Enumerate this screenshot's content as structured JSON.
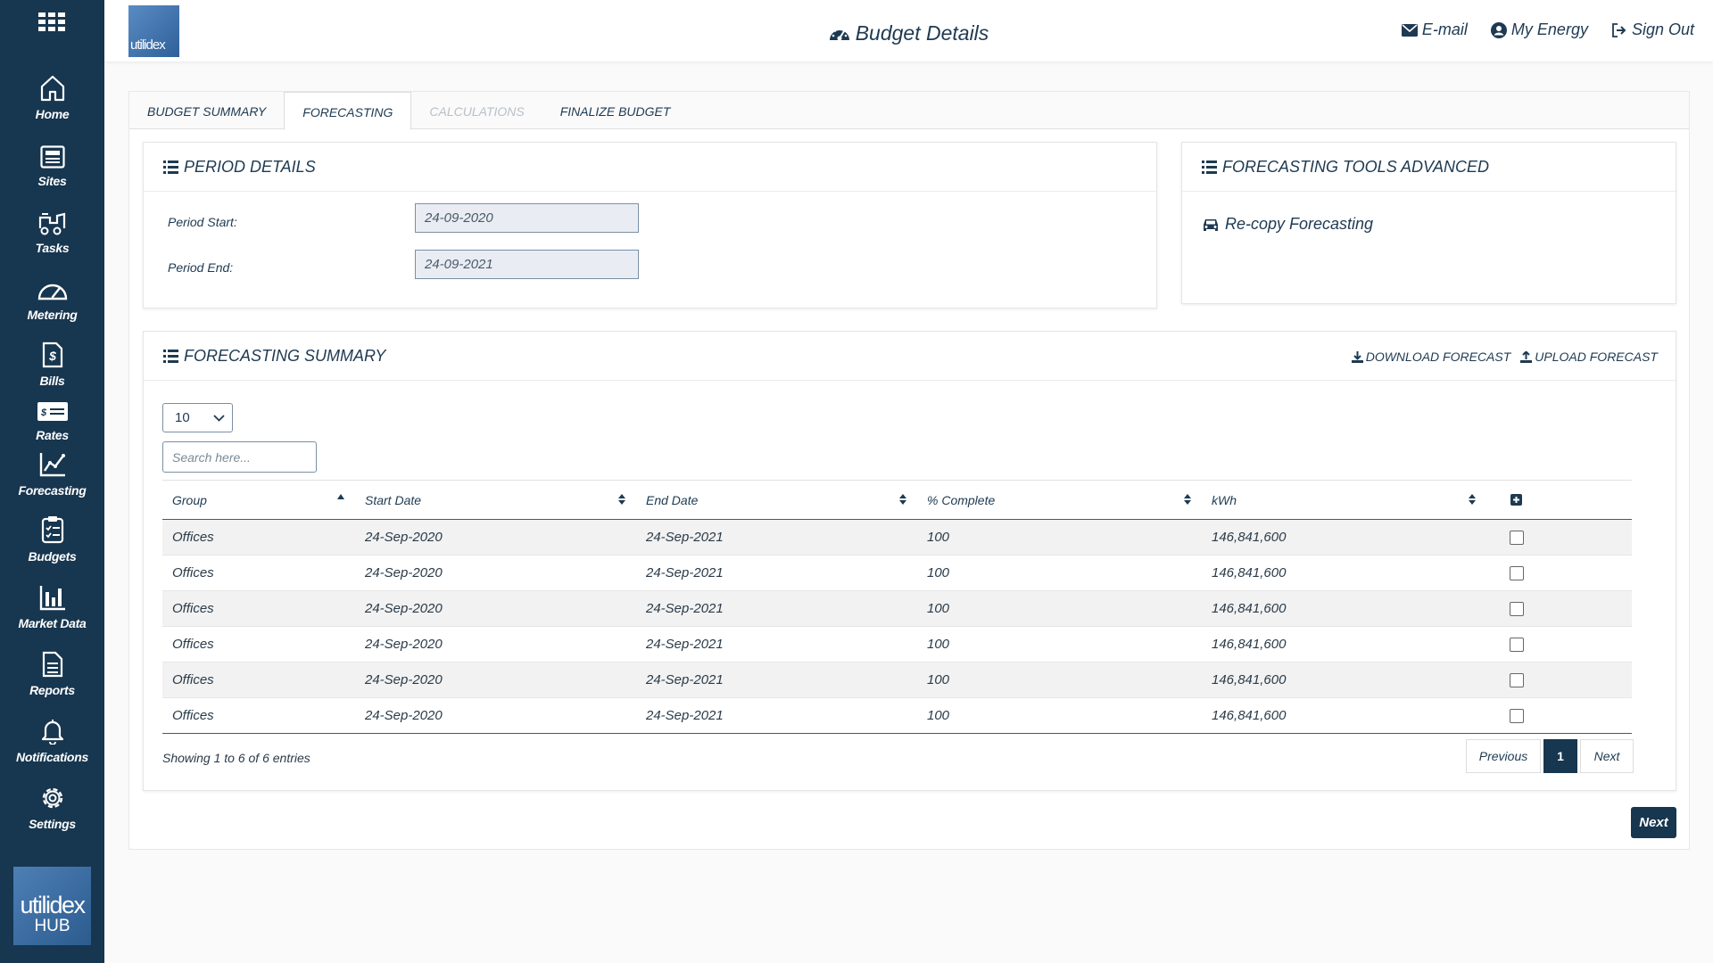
{
  "sidebar": {
    "items": [
      {
        "label": "Home",
        "icon": "home-icon"
      },
      {
        "label": "Sites",
        "icon": "sites-icon"
      },
      {
        "label": "Tasks",
        "icon": "tasks-icon"
      },
      {
        "label": "Metering",
        "icon": "gauge-icon"
      },
      {
        "label": "Bills",
        "icon": "bill-icon"
      },
      {
        "label": "Rates",
        "icon": "rates-icon"
      },
      {
        "label": "Forecasting",
        "icon": "line-chart-icon"
      },
      {
        "label": "Budgets",
        "icon": "clipboard-icon"
      },
      {
        "label": "Market Data",
        "icon": "bar-chart-icon"
      },
      {
        "label": "Reports",
        "icon": "report-icon"
      },
      {
        "label": "Notifications",
        "icon": "bell-icon"
      },
      {
        "label": "Settings",
        "icon": "gear-icon"
      }
    ],
    "logo": {
      "line1": "utilidex",
      "line2": "HUB"
    }
  },
  "header": {
    "logo_text": "utilidex",
    "title": "Budget Details",
    "links": {
      "email": "E-mail",
      "my_energy": "My Energy",
      "sign_out": "Sign Out"
    }
  },
  "tabs": [
    {
      "label": "BUDGET SUMMARY"
    },
    {
      "label": "FORECASTING"
    },
    {
      "label": "CALCULATIONS"
    },
    {
      "label": "FINALIZE BUDGET"
    }
  ],
  "period": {
    "title": "PERIOD DETAILS",
    "start_label": "Period Start:",
    "start_value": "24-09-2020",
    "end_label": "Period End:",
    "end_value": "24-09-2021"
  },
  "tools": {
    "title": "FORECASTING TOOLS ADVANCED",
    "recopy": "Re-copy Forecasting"
  },
  "summary": {
    "title": "FORECASTING SUMMARY",
    "download": "DOWNLOAD FORECAST",
    "upload": "UPLOAD FORECAST",
    "page_length": "10",
    "search_placeholder": "Search here...",
    "columns": [
      "Group",
      "Start Date",
      "End Date",
      "% Complete",
      "kWh"
    ],
    "rows": [
      [
        "Offices",
        "24-Sep-2020",
        "24-Sep-2021",
        "100",
        "146,841,600"
      ],
      [
        "Offices",
        "24-Sep-2020",
        "24-Sep-2021",
        "100",
        "146,841,600"
      ],
      [
        "Offices",
        "24-Sep-2020",
        "24-Sep-2021",
        "100",
        "146,841,600"
      ],
      [
        "Offices",
        "24-Sep-2020",
        "24-Sep-2021",
        "100",
        "146,841,600"
      ],
      [
        "Offices",
        "24-Sep-2020",
        "24-Sep-2021",
        "100",
        "146,841,600"
      ],
      [
        "Offices",
        "24-Sep-2020",
        "24-Sep-2021",
        "100",
        "146,841,600"
      ]
    ],
    "info": "Showing 1 to 6 of 6 entries",
    "pager": {
      "previous": "Previous",
      "page": "1",
      "next": "Next"
    }
  },
  "next_button": "Next",
  "colors": {
    "sidebar": "#17364f",
    "text": "#1e3a52",
    "accent": "#17364f"
  }
}
